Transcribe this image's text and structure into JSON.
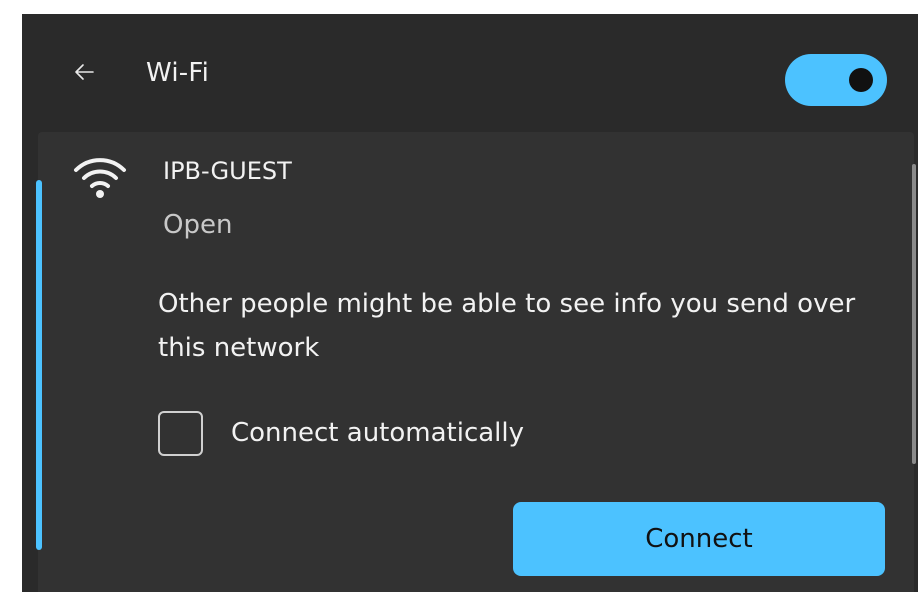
{
  "header": {
    "back_icon": "back-arrow-icon",
    "title": "Wi-Fi",
    "toggle_state": "on"
  },
  "network": {
    "icon": "wifi-signal-icon",
    "name": "IPB-GUEST",
    "status": "Open",
    "warning": "Other people might be able to see info you send over this network",
    "auto_connect_label": "Connect automatically",
    "auto_connect_checked": false,
    "connect_label": "Connect"
  },
  "colors": {
    "accent": "#4cc2ff",
    "panel_bg": "#2a2a2a",
    "card_bg": "#323232",
    "text": "#f2f2f2"
  }
}
